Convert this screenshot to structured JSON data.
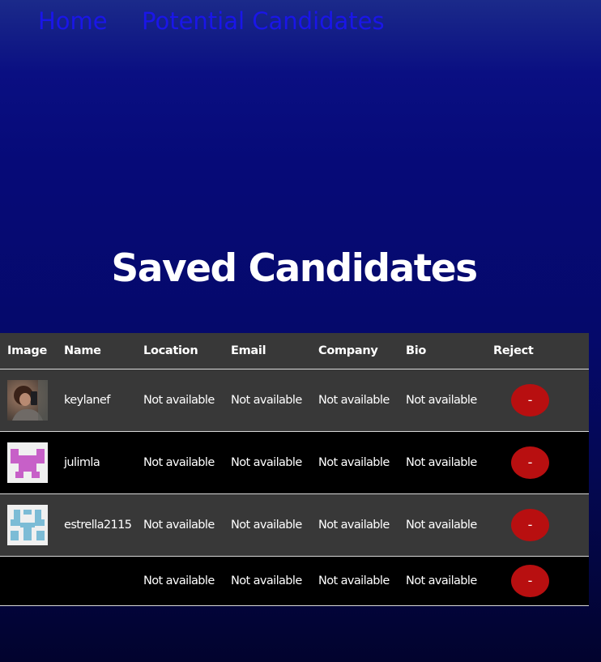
{
  "nav": {
    "home": "Home",
    "potential": "Potential Candidates"
  },
  "page": {
    "title": "Saved Candidates"
  },
  "table": {
    "headers": [
      "Image",
      "Name",
      "Location",
      "Email",
      "Company",
      "Bio",
      "Reject"
    ],
    "rows": [
      {
        "name": "keylanef",
        "location": "Not available",
        "email": "Not available",
        "company": "Not available",
        "bio": "Not available",
        "reject": "-",
        "avatar": "photo-avatar"
      },
      {
        "name": "julimla",
        "location": "Not available",
        "email": "Not available",
        "company": "Not available",
        "bio": "Not available",
        "reject": "-",
        "avatar": "identicon-pink"
      },
      {
        "name": "estrella2115",
        "location": "Not available",
        "email": "Not available",
        "company": "Not available",
        "bio": "Not available",
        "reject": "-",
        "avatar": "identicon-blue"
      },
      {
        "name": "",
        "location": "Not available",
        "email": "Not available",
        "company": "Not available",
        "bio": "Not available",
        "reject": "-",
        "avatar": ""
      }
    ]
  },
  "colors": {
    "nav_link": "#1a16e8",
    "row_dark": "#000000",
    "row_gray": "#383838",
    "reject": "#b80f10"
  }
}
